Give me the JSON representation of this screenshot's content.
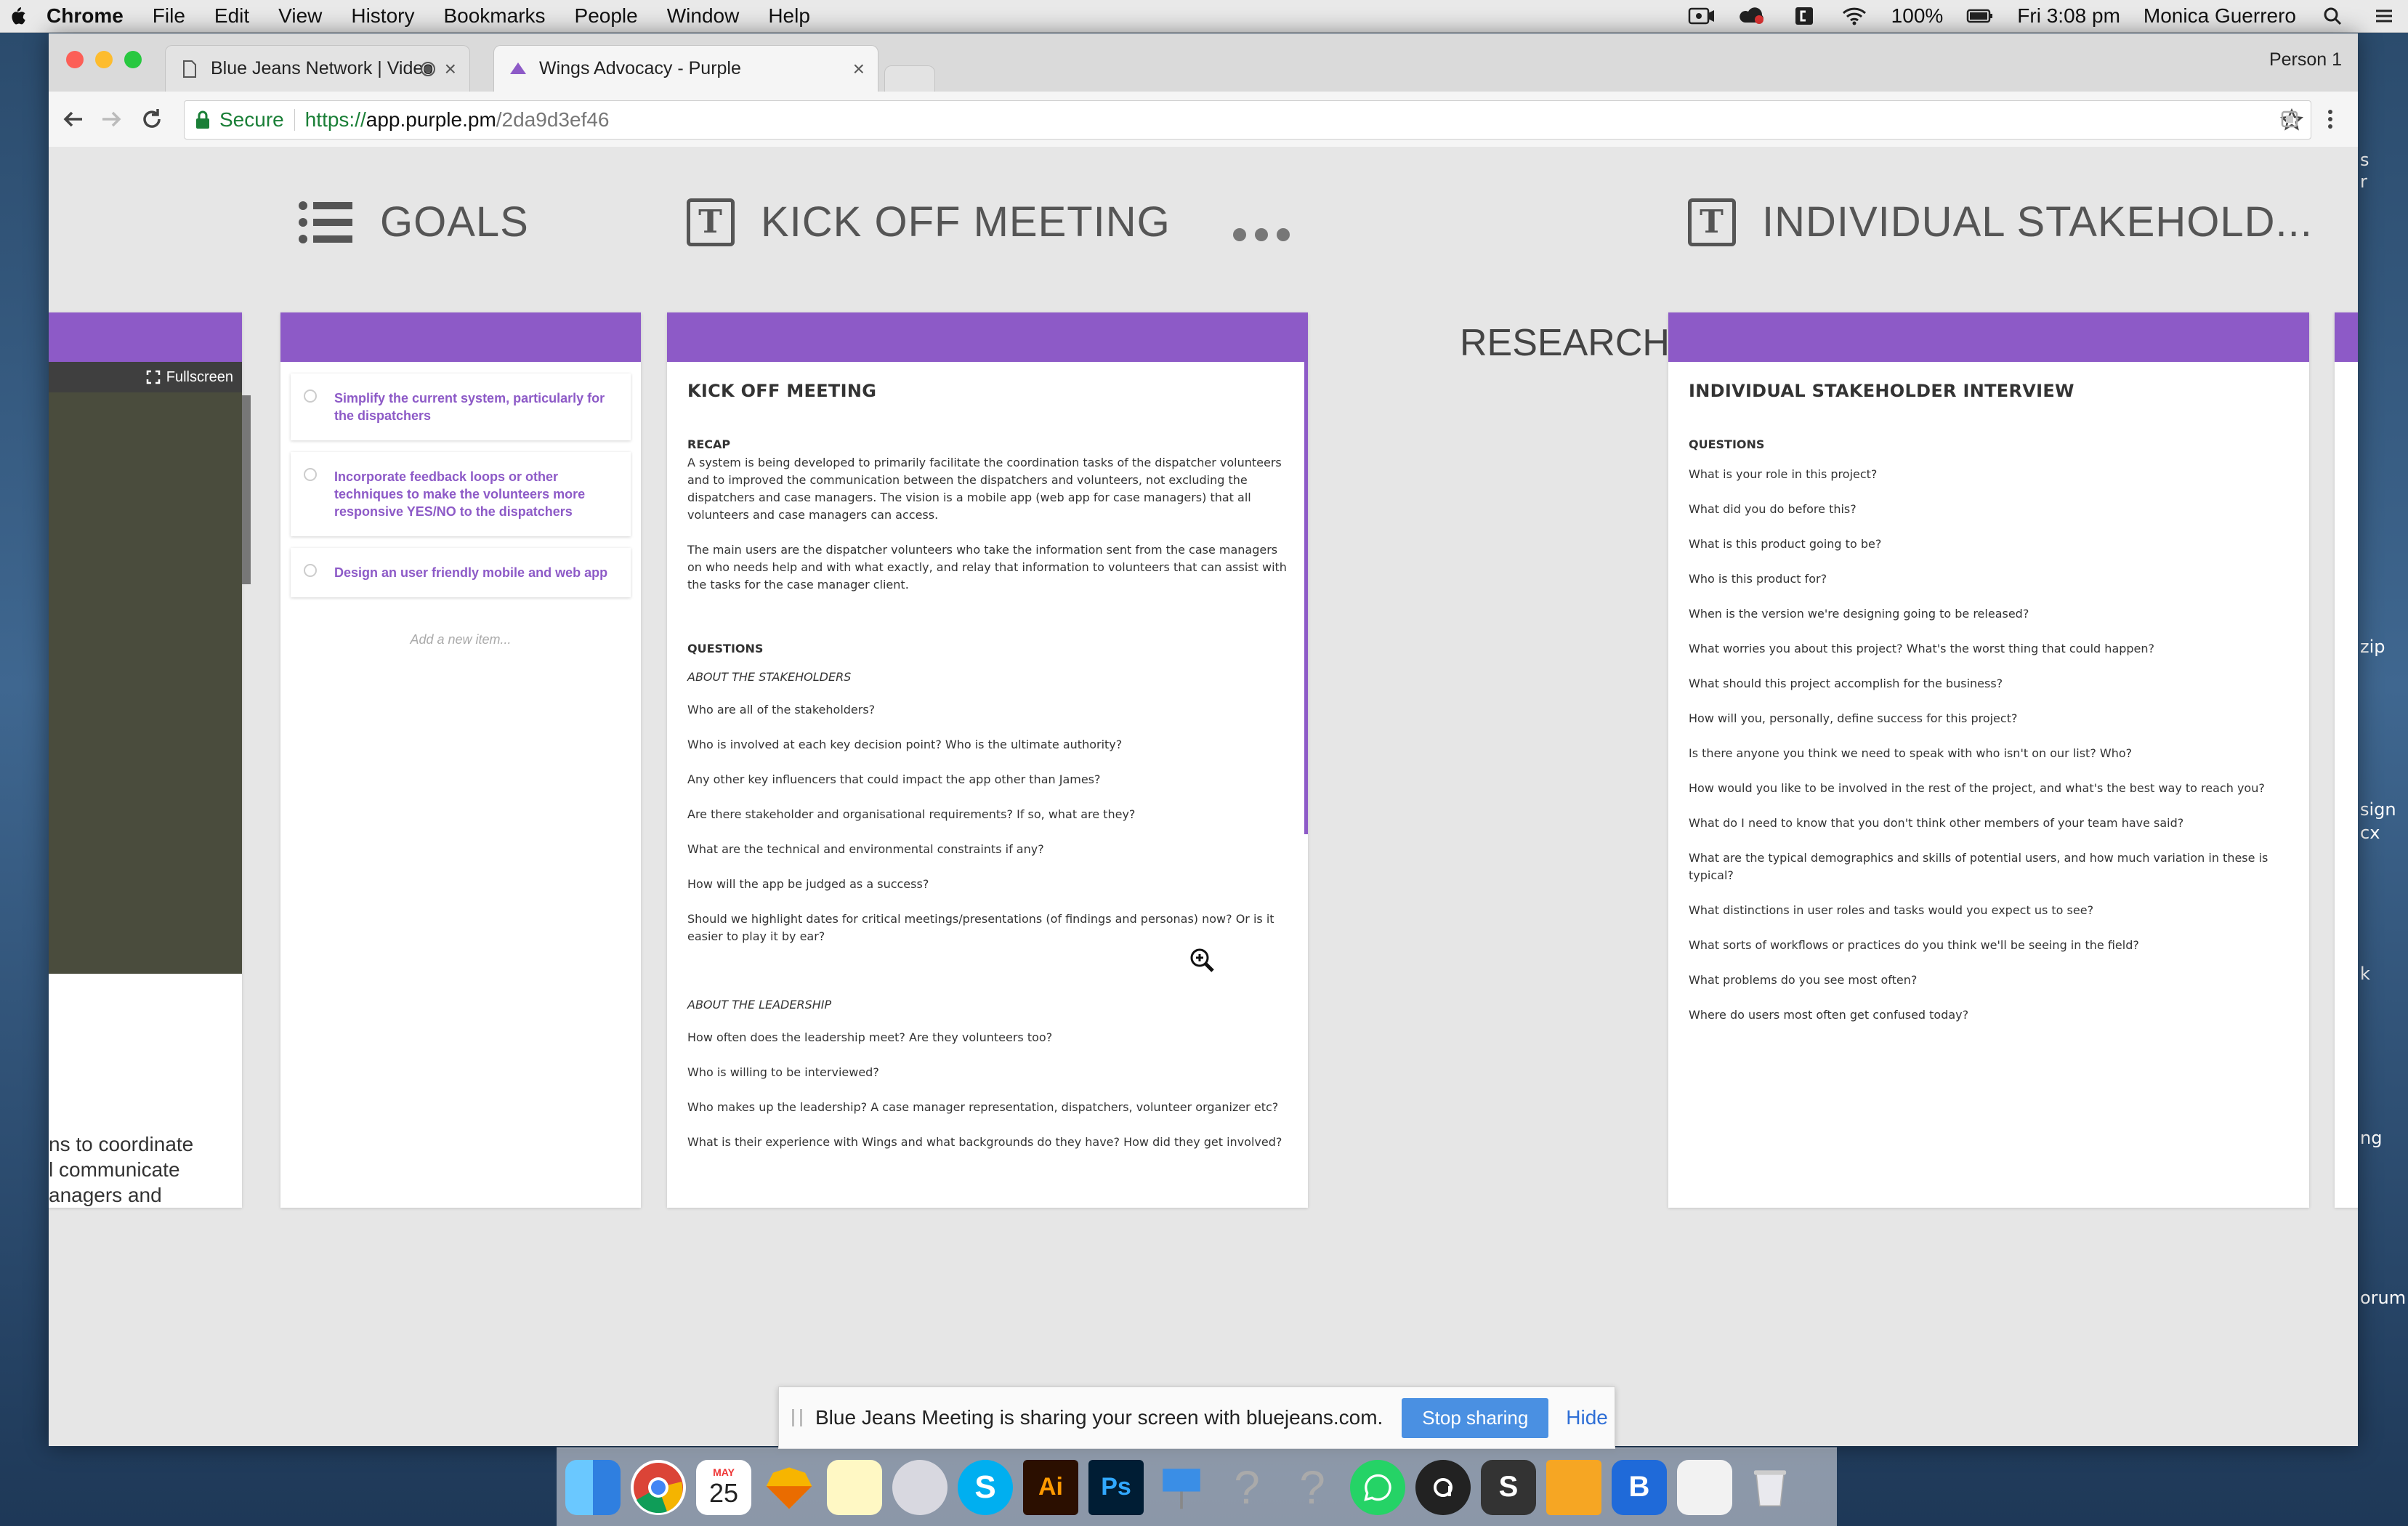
{
  "menubar": {
    "app": "Chrome",
    "items": [
      "File",
      "Edit",
      "View",
      "History",
      "Bookmarks",
      "People",
      "Window",
      "Help"
    ],
    "battery": "100%",
    "clock": "Fri 3:08 pm",
    "user": "Monica Guerrero"
  },
  "desktop": {
    "labels": [
      "s",
      "r",
      "zip",
      "sign",
      "cx",
      "k",
      "ng",
      "orum"
    ]
  },
  "browser": {
    "tabs": [
      {
        "title": "Blue Jeans Network | Video"
      },
      {
        "title": "Wings Advocacy - Purple"
      }
    ],
    "profile": "Person 1",
    "address": {
      "secure_label": "Secure",
      "scheme": "https://",
      "host": "app.purple.pm",
      "path": "/2da9d3ef46"
    }
  },
  "board": {
    "titles": {
      "goals": "GOALS",
      "kickoff": "KICK OFF MEETING",
      "stakeholder": "INDIVIDUAL STAKEHOLD..."
    },
    "research_label": "RESEARCH",
    "video_card": {
      "fullscreen_label": "Fullscreen",
      "lines": [
        "ns to coordinate",
        "l communicate",
        "anagers and"
      ]
    },
    "goals": {
      "items": [
        "Simplify the current system, particularly for the dispatchers",
        "Incorporate feedback loops or other techniques to make the volunteers more responsive YES/NO to the dispatchers",
        "Design an user friendly mobile and web app"
      ],
      "add_placeholder": "Add a new item..."
    },
    "kickoff_doc": {
      "heading": "KICK OFF MEETING",
      "recap_title": "RECAP",
      "recap_p1": "A system is being developed to primarily facilitate the coordination tasks of the dispatcher volunteers and to improved the communication between the dispatchers and volunteers, not excluding the dispatchers and case managers. The vision is a mobile app (web app for case managers) that all volunteers and case managers can access.",
      "recap_p2": "The main users are the dispatcher volunteers who take the information sent from the case managers on who needs help and with what exactly, and relay that information to volunteers that can assist with the tasks for the case manager client.",
      "questions_title": "QUESTIONS",
      "section1": "ABOUT THE STAKEHOLDERS",
      "q1": [
        "Who are all of the stakeholders?",
        "Who is involved at each key decision point? Who is the ultimate authority?",
        "Any other key influencers that could impact the app other than James?",
        "Are there stakeholder and organisational requirements? If so, what are they?",
        "What are the technical and environmental constraints if any?",
        "How will the app be judged as a success?",
        "Should we highlight dates for critical meetings/presentations (of findings and personas) now? Or is it easier to play it by ear?"
      ],
      "section2": "ABOUT THE LEADERSHIP",
      "q2": [
        "How often does the leadership meet? Are they volunteers too?",
        "Who is willing to be interviewed?",
        "Who makes up the leadership?  A case manager representation, dispatchers, volunteer organizer etc?",
        "What is their experience with Wings and what backgrounds do they have? How did they get involved?"
      ]
    },
    "stakeholder_doc": {
      "heading": "INDIVIDUAL STAKEHOLDER INTERVIEW",
      "questions_title": "QUESTIONS",
      "questions": [
        "What is your role in this project?",
        "What did you do before this?",
        "What is this product going to be?",
        "Who is this product for?",
        "When is the version we're designing going to be released?",
        "What worries you about this project? What's the worst thing that could happen?",
        "What should this project accomplish for the business?",
        "How will you, personally, define success for this project?",
        "Is there anyone you think we need to speak with who isn't on our list? Who?",
        "How would you like to be involved in the rest of the project, and what's the best way to reach you?",
        "What do I need to know that you don't think other members of your team have said?",
        "What are the typical demographics and skills of potential users, and how much variation in these is typical?",
        "What distinctions in user roles and tasks would you expect us to see?",
        "What sorts of workflows or practices do you think we'll be seeing in the field?",
        "What problems do you see most often?",
        "Where do users most often get confused today?"
      ]
    }
  },
  "sharebar": {
    "message": "Blue Jeans Meeting is sharing your screen with bluejeans.com.",
    "stop_label": "Stop sharing",
    "hide_label": "Hide"
  },
  "dock": {
    "icons": [
      "finder-icon",
      "chrome-icon",
      "calendar-icon",
      "sketch-icon",
      "notes-icon",
      "launchpad-icon",
      "skype-icon",
      "illustrator-icon",
      "photoshop-icon",
      "keynote-icon",
      "unknown-app-icon",
      "unknown-app-icon",
      "whatsapp-icon",
      "abstract-icon",
      "scrivener-icon",
      "pages-icon",
      "bluejeans-icon",
      "documents-icon",
      "trash-icon"
    ],
    "calendar_month": "MAY",
    "calendar_day": "25",
    "illustrator_label": "Ai",
    "photoshop_label": "Ps"
  },
  "colors": {
    "accent": "#8d5ac7",
    "stop_button": "#4a90e2"
  }
}
